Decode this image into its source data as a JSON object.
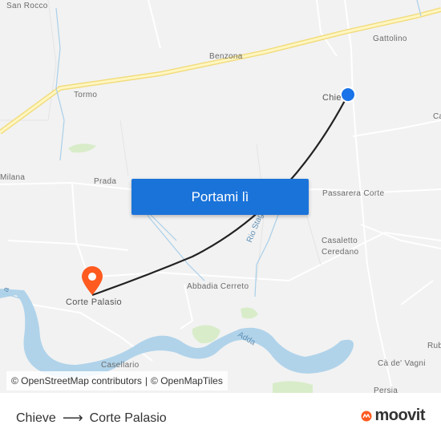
{
  "map": {
    "places": {
      "san_rocco": "San Rocco",
      "gattolino": "Gattolino",
      "benzona": "Benzona",
      "tormo": "Tormo",
      "chieve": "Chie",
      "ca": "Ca",
      "milana": "Milana",
      "prada": "Prada",
      "passarera_corte": "Passarera Corte",
      "casaletto": "Casaletto",
      "ceredano": "Ceredano",
      "abbadia_cerreto": "Abbadia Cerreto",
      "corte_palasio": "Corte Palasio",
      "rub": "Rub",
      "ca_de_vagni": "Cà de' Vagni",
      "casellario": "Casellario",
      "persia": "Persia"
    },
    "rivers": {
      "rio_stagno": "Rio Stagno",
      "adda": "Adda",
      "a": "a"
    },
    "origin_marker_color": "#1a73e8",
    "destination_marker_color": "#ff5a1f"
  },
  "cta": {
    "label": "Portami lì"
  },
  "attribution": {
    "osm": "© OpenStreetMap contributors",
    "separator": "|",
    "omt": "© OpenMapTiles"
  },
  "footer": {
    "origin": "Chieve",
    "arrow": "⟶",
    "destination": "Corte Palasio",
    "brand": "moovit",
    "brand_color": "#ff5a1f"
  }
}
